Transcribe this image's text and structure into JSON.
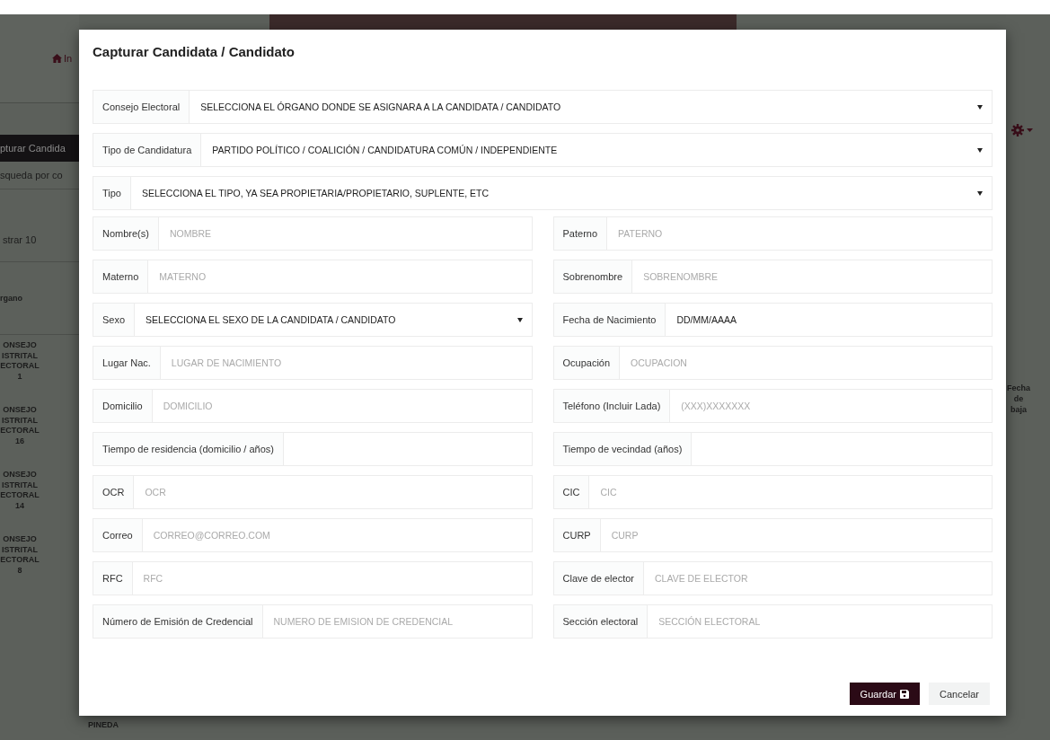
{
  "background": {
    "home_link": "In",
    "tab": "pturar Candida",
    "search_label": "squeda por co",
    "show_label": "strar 10",
    "column_header": "rgano",
    "column_header_right": "Fecha de baja",
    "cells": [
      "ONSEJO ISTRITAL ECTORAL 1",
      "ONSEJO ISTRITAL ECTORAL 16",
      "ONSEJO ISTRITAL ECTORAL 14",
      "ONSEJO ISTRITAL ECTORAL 8"
    ],
    "name_cell": "PINEDA"
  },
  "modal": {
    "title": "Capturar Candidata / Candidato",
    "selects": [
      {
        "label": "Consejo Electoral",
        "value": "SELECCIONA EL ÓRGANO DONDE SE ASIGNARA A LA CANDIDATA / CANDIDATO"
      },
      {
        "label": "Tipo de Candidatura",
        "value": "PARTIDO POLÍTICO / COALICIÓN / CANDIDATURA COMÚN / INDEPENDIENTE"
      },
      {
        "label": "Tipo",
        "value": "SELECCIONA EL TIPO, YA SEA PROPIETARIA/PROPIETARIO, SUPLENTE, ETC"
      }
    ],
    "fields": [
      {
        "kind": "text",
        "label": "Nombre(s)",
        "placeholder": "NOMBRE"
      },
      {
        "kind": "text",
        "label": "Paterno",
        "placeholder": "PATERNO"
      },
      {
        "kind": "text",
        "label": "Materno",
        "placeholder": "MATERNO"
      },
      {
        "kind": "text",
        "label": "Sobrenombre",
        "placeholder": "SOBRENOMBRE"
      },
      {
        "kind": "select",
        "label": "Sexo",
        "value": "SELECCIONA EL SEXO DE LA CANDIDATA / CANDIDATO"
      },
      {
        "kind": "text",
        "label": "Fecha de Nacimiento",
        "value": "DD/MM/AAAA"
      },
      {
        "kind": "text",
        "label": "Lugar Nac.",
        "placeholder": "LUGAR DE NACIMIENTO"
      },
      {
        "kind": "text",
        "label": "Ocupación",
        "placeholder": "OCUPACION"
      },
      {
        "kind": "text",
        "label": "Domicilio",
        "placeholder": "DOMICILIO"
      },
      {
        "kind": "text",
        "label": "Teléfono (Incluir Lada)",
        "placeholder": "(XXX)XXXXXXX"
      },
      {
        "kind": "text",
        "label": "Tiempo de residencia (domicilio / años)"
      },
      {
        "kind": "text",
        "label": "Tiempo de vecindad (años)"
      },
      {
        "kind": "text",
        "label": "OCR",
        "placeholder": "OCR"
      },
      {
        "kind": "text",
        "label": "CIC",
        "placeholder": "CIC"
      },
      {
        "kind": "text",
        "label": "Correo",
        "placeholder": "CORREO@CORREO.COM"
      },
      {
        "kind": "text",
        "label": "CURP",
        "placeholder": "CURP"
      },
      {
        "kind": "text",
        "label": "RFC",
        "placeholder": "RFC"
      },
      {
        "kind": "text",
        "label": "Clave de elector",
        "placeholder": "CLAVE DE ELECTOR"
      },
      {
        "kind": "text",
        "label": "Número de Emisión de Credencial",
        "placeholder": "NUMERO DE EMISION DE CREDENCIAL"
      },
      {
        "kind": "text",
        "label": "Sección electoral",
        "placeholder": "SECCIÓN ELECTORAL"
      }
    ],
    "buttons": [
      {
        "kind": "primary",
        "label": "Guardar"
      },
      {
        "kind": "secondary",
        "label": "Cancelar"
      }
    ]
  }
}
